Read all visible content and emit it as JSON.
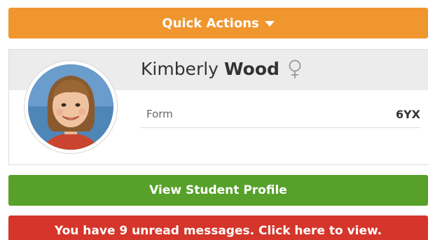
{
  "quick_actions": {
    "label": "Quick Actions",
    "icon": "caret-down-icon",
    "color": "#f0962e"
  },
  "student": {
    "first_name": "Kimberly",
    "last_name": "Wood",
    "gender_icon": "female-icon",
    "avatar_icon": "student-photo",
    "fields": [
      {
        "label": "Form",
        "value": "6YX"
      }
    ]
  },
  "profile_button": {
    "label": "View Student Profile",
    "color": "#57a12b"
  },
  "messages_banner": {
    "label": "You have 9 unread messages. Click here to view.",
    "color": "#d5352a"
  }
}
